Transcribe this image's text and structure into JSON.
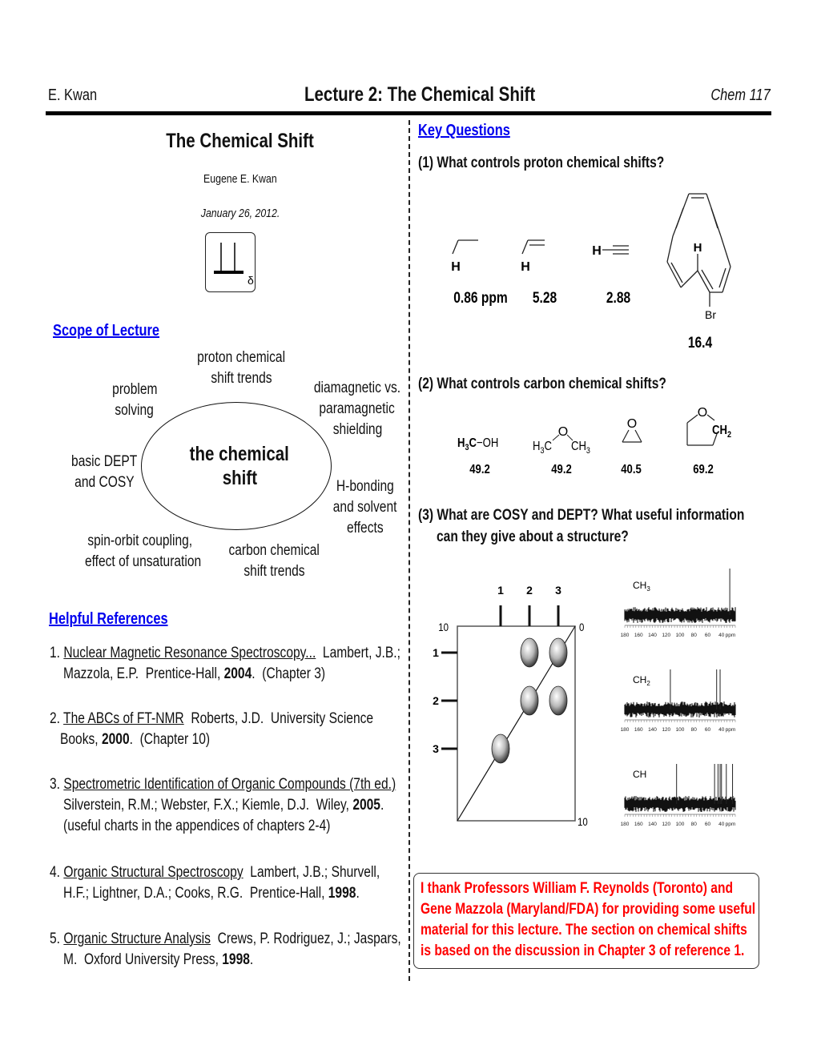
{
  "header": {
    "author": "E. Kwan",
    "title": "Lecture 2: The Chemical Shift",
    "course": "Chem 117"
  },
  "cover": {
    "title": "The Chemical Shift",
    "author": "Eugene E. Kwan",
    "date": "January 26, 2012.",
    "logo_symbol": "δ"
  },
  "scope": {
    "title": "Scope of Lecture",
    "center": [
      "the chemical",
      "shift"
    ],
    "topics": [
      [
        "proton chemical",
        "shift trends"
      ],
      [
        "diamagnetic vs.",
        "paramagnetic",
        "shielding"
      ],
      [
        "H-bonding",
        "and solvent",
        "effects"
      ],
      [
        "carbon chemical",
        "shift trends"
      ],
      [
        "spin-orbit coupling,",
        "effect of unsaturation"
      ],
      [
        "basic DEPT",
        "and COSY"
      ],
      [
        "problem",
        "solving"
      ]
    ]
  },
  "references": {
    "title": "Helpful References",
    "items": [
      {
        "num": "1.",
        "title": "Nuclear Magnetic Resonance Spectroscopy...",
        "rest1": "  Lambert, J.B.;",
        "line2_pre": "Mazzola, E.P.  Prentice-Hall, ",
        "year": "2004",
        "line2_post": ".  (Chapter 3)"
      },
      {
        "num": "2.",
        "title": "The ABCs of FT-NMR",
        "rest1": "  Roberts, J.D.  University Science",
        "line2_pre": "Books, ",
        "year": "2000",
        "line2_post": ".  (Chapter 10)"
      },
      {
        "num": "3.",
        "title": "Spectrometric Identification of Organic Compounds (7th ed.)",
        "rest1": "",
        "line2_pre": "Silverstein, R.M.; Webster, F.X.; Kiemle, D.J.  Wiley, ",
        "year": "2005",
        "line2_post": ".",
        "line3": "(useful charts in the appendices of chapters 2-4)"
      },
      {
        "num": "4.",
        "title": "Organic Structural Spectroscopy",
        "rest1": "  Lambert, J.B.; Shurvell,",
        "line2_pre": "H.F.; Lightner, D.A.; Cooks, R.G.  Prentice-Hall, ",
        "year": "1998",
        "line2_post": "."
      },
      {
        "num": "5.",
        "title": "Organic Structure Analysis",
        "rest1": "  Crews, P. Rodriguez, J.; Jaspars,",
        "line2_pre": "M.  Oxford University Press, ",
        "year": "1998",
        "line2_post": "."
      }
    ]
  },
  "key_questions": {
    "title": "Key Questions",
    "q1": "(1) What controls proton chemical shifts?",
    "q1_examples": [
      {
        "label": "H",
        "value": "0.86 ppm"
      },
      {
        "label": "H",
        "value": "5.28"
      },
      {
        "label": "H",
        "value": "2.88"
      },
      {
        "label_h": "H",
        "label_br": "Br",
        "value": "16.4"
      }
    ],
    "q2": "(2) What controls carbon chemical shifts?",
    "q2_examples": [
      {
        "formula": "H3C−OH",
        "value": "49.2"
      },
      {
        "formula": "H3C-O-CH3",
        "value": "49.2"
      },
      {
        "formula": "oxirane",
        "atom": "O",
        "value": "40.5"
      },
      {
        "formula": "THF",
        "atom": "O",
        "group": "CH2",
        "value": "69.2"
      }
    ],
    "q3_line1": "(3) What are COSY and DEPT?  What useful information",
    "q3_line2": "can they give about a structure?"
  },
  "cosy": {
    "top_labels": [
      "1",
      "2",
      "3"
    ],
    "side_labels": [
      "1",
      "2",
      "3"
    ],
    "axis_top_left": "10",
    "axis_top_right": "0",
    "axis_bottom_right": "10",
    "crosspeaks": [
      [
        2,
        1
      ],
      [
        3,
        1
      ],
      [
        2,
        2
      ],
      [
        3,
        2
      ],
      [
        1,
        3
      ]
    ]
  },
  "dept": {
    "spectra": [
      {
        "label": "CH3",
        "peaks_ppm": [
          28
        ]
      },
      {
        "label": "CH2",
        "peaks_ppm": [
          114,
          47,
          42
        ]
      },
      {
        "label": "CH",
        "peaks_ppm": [
          105,
          50,
          45,
          42,
          40,
          33,
          24
        ]
      }
    ],
    "ticks": [
      "180",
      "160",
      "140",
      "120",
      "100",
      "80",
      "60",
      "40",
      "ppm"
    ]
  },
  "acknowledgement": {
    "lines": [
      "I thank Professors William F. Reynolds (Toronto) and",
      "Gene Mazzola (Maryland/FDA) for providing some useful",
      "material for this lecture.  The section on chemical shifts",
      "is based on the discussion in Chapter 3 of reference 1."
    ],
    "color": "#ff0000"
  },
  "colors": {
    "link": "#0000ee",
    "text": "#111111"
  }
}
